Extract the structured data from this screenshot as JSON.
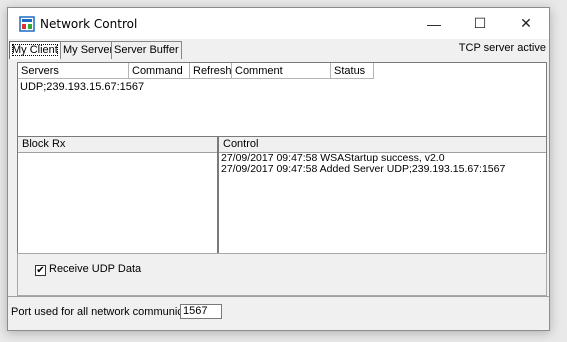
{
  "window": {
    "title": "Network Control",
    "minimize_glyph": "—",
    "maximize_glyph": "☐",
    "close_glyph": "✕"
  },
  "tabs": [
    {
      "label": "My Client",
      "active": true
    },
    {
      "label": "My Server",
      "active": false
    },
    {
      "label": "Server Buffer",
      "active": false
    }
  ],
  "server_status": "TCP server active",
  "servers_table": {
    "columns": [
      "Servers",
      "Command",
      "Refresh",
      "Comment",
      "Status"
    ],
    "rows": [
      "UDP;239.193.15.67:1567"
    ]
  },
  "block_rx": {
    "header": "Block Rx"
  },
  "control": {
    "header": "Control",
    "log": [
      "27/09/2017 09:47:58  WSAStartup success, v2.0",
      "27/09/2017 09:47:58  Added Server UDP;239.193.15.67:1567"
    ]
  },
  "receive_udp": {
    "label": "Receive UDP Data",
    "checked": true,
    "check_glyph": "✔"
  },
  "port": {
    "label": "Port used for all network communications:",
    "value": "1567"
  },
  "icons": {
    "app": "network-control-app-icon"
  }
}
